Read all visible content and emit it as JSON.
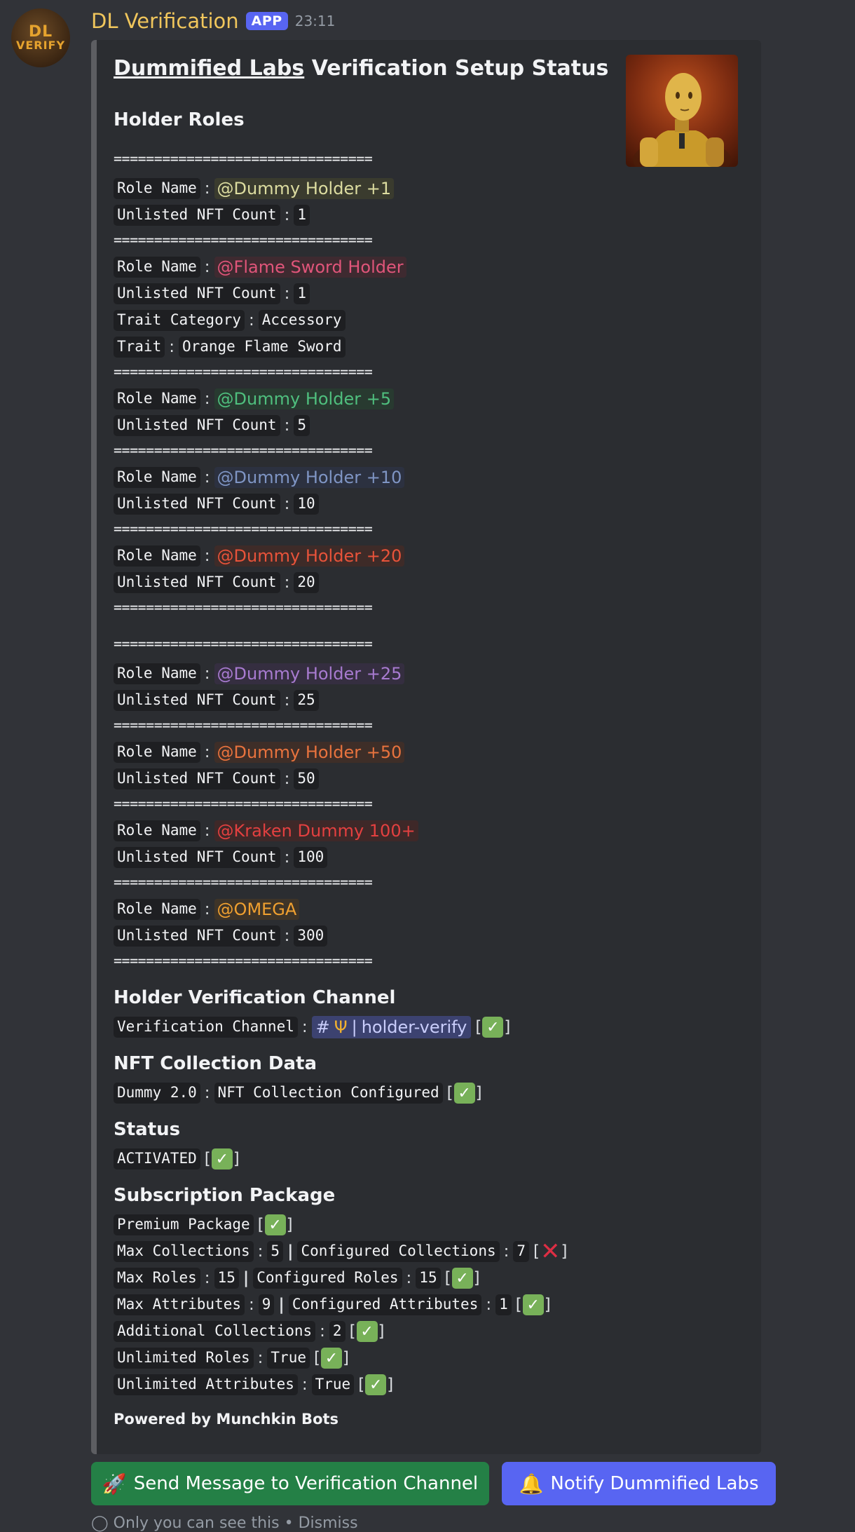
{
  "message": {
    "bot_name": "DL Verification",
    "badge": "APP",
    "time": "23:11",
    "avatar": {
      "line1": "DL",
      "line2": "VERIFY"
    }
  },
  "embed": {
    "title_link": "Dummified Labs",
    "title_rest": " Verification Setup Status",
    "holder_roles_title": "Holder Roles",
    "separator": "================================",
    "labels": {
      "role_name": "Role Name",
      "unlisted": "Unlisted NFT Count",
      "trait_category": "Trait Category",
      "trait": "Trait"
    },
    "roles": [
      {
        "name": "@Dummy Holder +1",
        "count": "1",
        "color": "#dcdca0",
        "bg": "#3a3b2e"
      },
      {
        "name": "@Flame Sword Holder",
        "count": "1",
        "color": "#e0557a",
        "bg": "#3e2a30",
        "trait_category": "Accessory",
        "trait": "Orange Flame Sword"
      },
      {
        "name": "@Dummy Holder +5",
        "count": "5",
        "color": "#4fbf7e",
        "bg": "#283a30"
      },
      {
        "name": "@Dummy Holder +10",
        "count": "10",
        "color": "#7f95c4",
        "bg": "#2c3140"
      },
      {
        "name": "@Dummy Holder +20",
        "count": "20",
        "color": "#e8533a",
        "bg": "#3e2b28"
      },
      {
        "name": "@Dummy Holder +25",
        "count": "25",
        "color": "#a87bd0",
        "bg": "#352e40"
      },
      {
        "name": "@Dummy Holder +50",
        "count": "50",
        "color": "#e8733e",
        "bg": "#3e2e28"
      },
      {
        "name": "@Kraken Dummy 100+",
        "count": "100",
        "color": "#e34040",
        "bg": "#3e2828"
      },
      {
        "name": "@OMEGA",
        "count": "300",
        "color": "#f0a030",
        "bg": "#3e3428"
      }
    ],
    "verification": {
      "title": "Holder Verification Channel",
      "label": "Verification Channel",
      "channel": "holder-verify"
    },
    "collection": {
      "title": "NFT Collection Data",
      "name": "Dummy 2.0",
      "value": "NFT Collection Configured"
    },
    "status": {
      "title": "Status",
      "value": "ACTIVATED"
    },
    "subscription": {
      "title": "Subscription Package",
      "package": "Premium Package",
      "max_collections_label": "Max Collections",
      "max_collections": "5",
      "configured_collections_label": "Configured Collections",
      "configured_collections": "7",
      "max_roles_label": "Max Roles",
      "max_roles": "15",
      "configured_roles_label": "Configured Roles",
      "configured_roles": "15",
      "max_attributes_label": "Max Attributes",
      "max_attributes": "9",
      "configured_attributes_label": "Configured Attributes",
      "configured_attributes": "1",
      "additional_collections_label": "Additional Collections",
      "additional_collections": "2",
      "unlimited_roles_label": "Unlimited Roles",
      "unlimited_roles": "True",
      "unlimited_attributes_label": "Unlimited Attributes",
      "unlimited_attributes": "True"
    },
    "footer": "Powered by Munchkin Bots"
  },
  "buttons": {
    "send": "Send Message to Verification Channel",
    "notify": "Notify Dummified Labs"
  },
  "cutoff_text": "Only you can see this • Dismiss",
  "colors": {
    "accent": "#5865f2",
    "success": "#248046",
    "check": "#78b159"
  }
}
